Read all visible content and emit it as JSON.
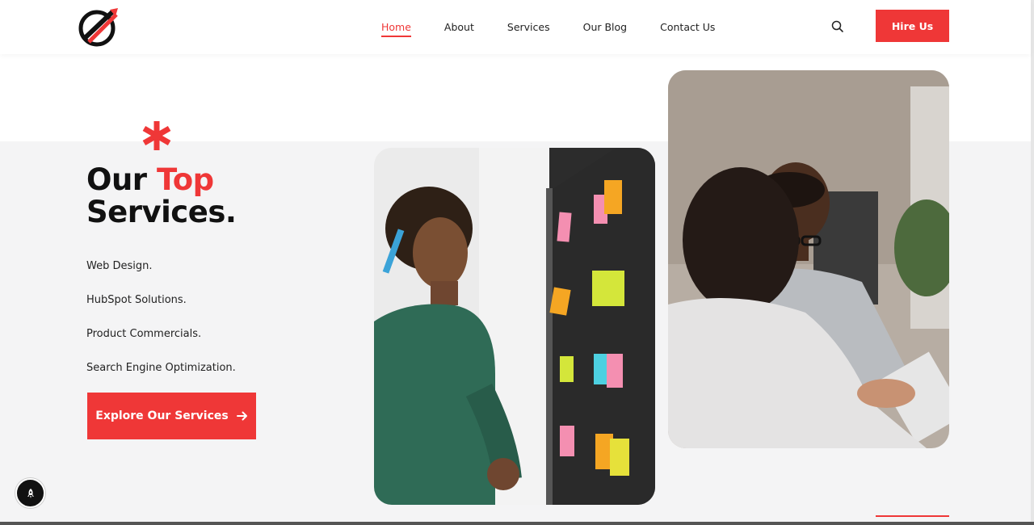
{
  "header": {
    "nav": [
      {
        "label": "Home",
        "active": true
      },
      {
        "label": "About",
        "active": false
      },
      {
        "label": "Services",
        "active": false
      },
      {
        "label": "Our Blog",
        "active": false
      },
      {
        "label": "Contact Us",
        "active": false
      }
    ],
    "cta_label": "Hire Us",
    "search_icon": "search-icon"
  },
  "hero": {
    "headline_part1": "Our ",
    "headline_accent": "Top",
    "headline_part2": "Services.",
    "services": [
      "Web Design.",
      "HubSpot Solutions.",
      "Product Commercials.",
      "Search Engine Optimization."
    ],
    "cta_label": "Explore Our Services",
    "cta_icon": "arrow-right-icon"
  },
  "colors": {
    "accent": "#ef3737",
    "dark": "#111111",
    "background": "#f4f4f5"
  },
  "floating": {
    "icon": "rocket-icon"
  }
}
